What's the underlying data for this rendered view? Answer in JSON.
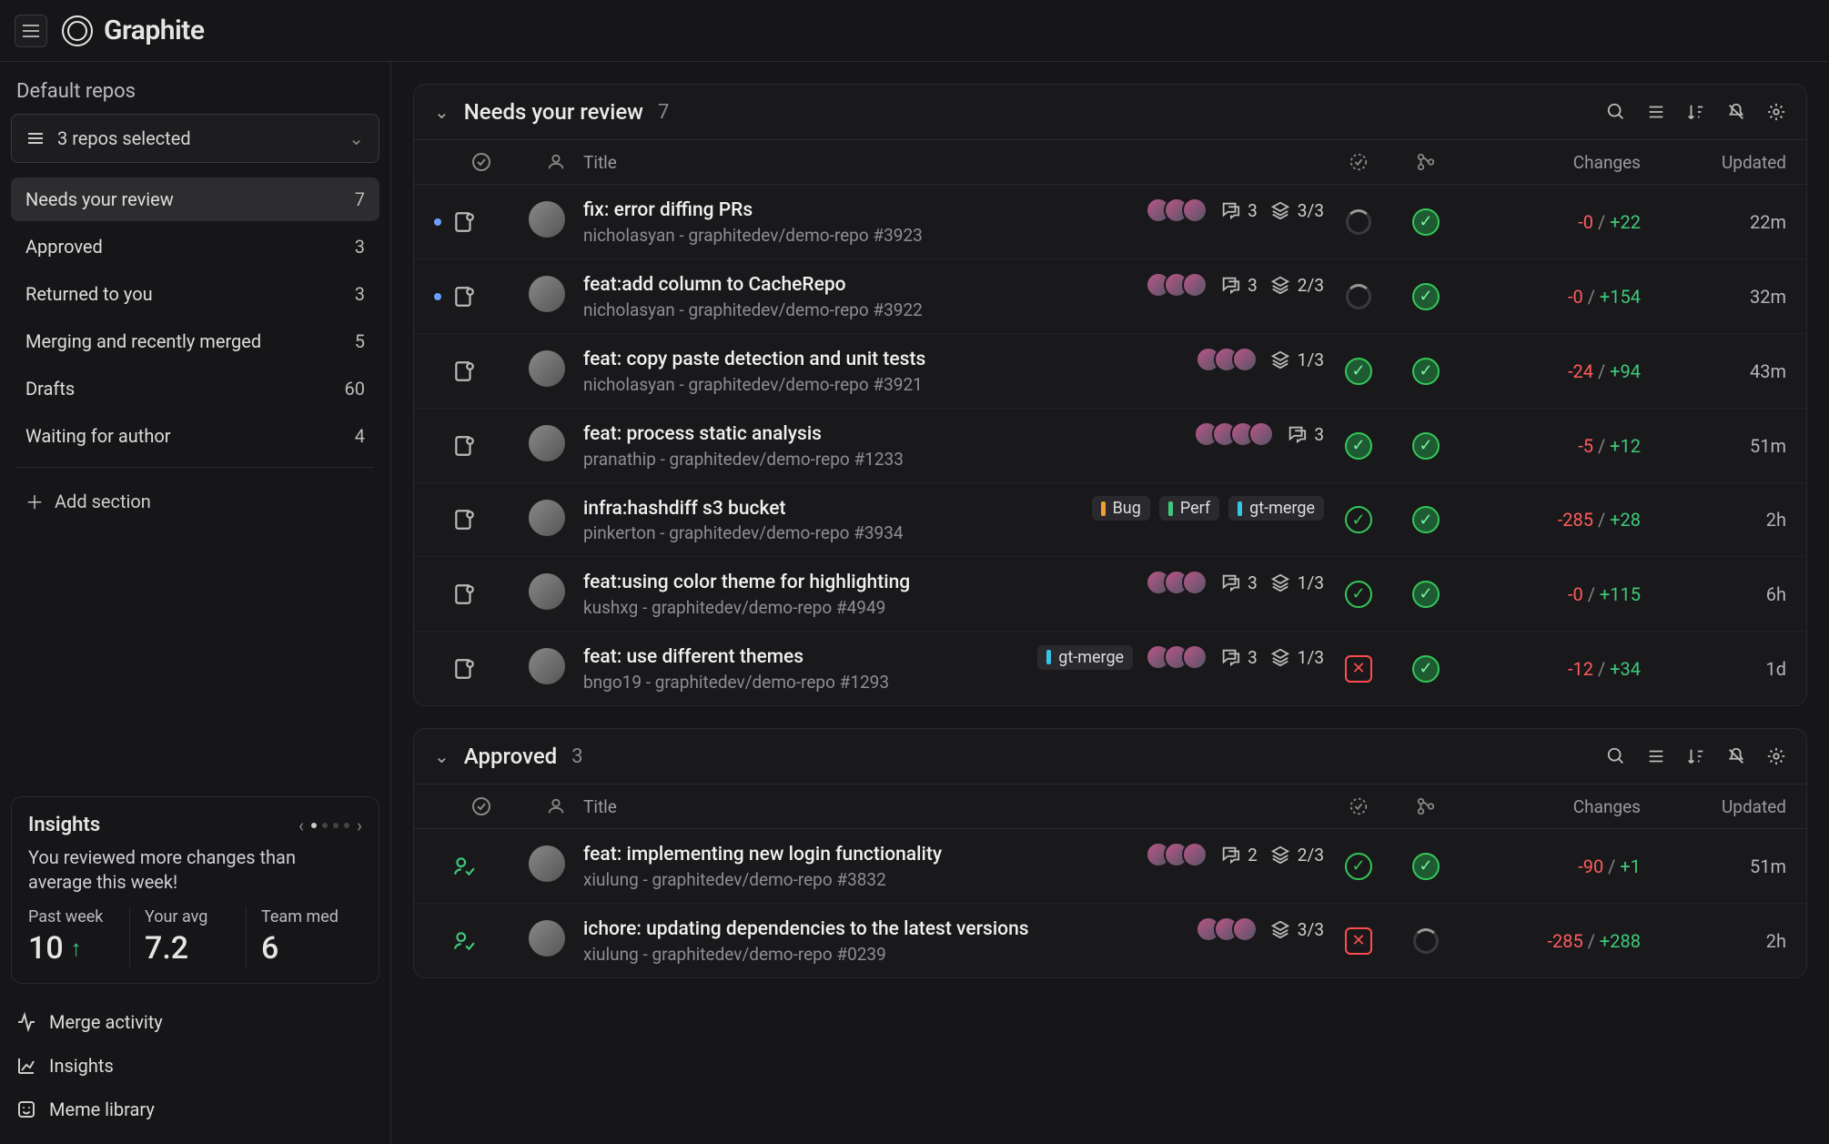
{
  "brand": "Graphite",
  "sidebar": {
    "heading": "Default repos",
    "repo_selected": "3 repos selected",
    "items": [
      {
        "label": "Needs your review",
        "count": "7"
      },
      {
        "label": "Approved",
        "count": "3"
      },
      {
        "label": "Returned to you",
        "count": "3"
      },
      {
        "label": "Merging and recently merged",
        "count": "5"
      },
      {
        "label": "Drafts",
        "count": "60"
      },
      {
        "label": "Waiting for author",
        "count": "4"
      }
    ],
    "add_section": "Add section",
    "links": {
      "merge_activity": "Merge activity",
      "insights": "Insights",
      "meme": "Meme library"
    }
  },
  "insights": {
    "title": "Insights",
    "message": "You reviewed more changes than average this week!",
    "stats": [
      {
        "label": "Past week",
        "value": "10",
        "trend": "up"
      },
      {
        "label": "Your avg",
        "value": "7.2"
      },
      {
        "label": "Team med",
        "value": "6"
      }
    ]
  },
  "columns": {
    "title": "Title",
    "changes": "Changes",
    "updated": "Updated"
  },
  "sections": [
    {
      "title": "Needs your review",
      "count": "7",
      "rows": [
        {
          "dot": true,
          "title": "fix: error diffing PRs",
          "meta": "nicholasyan - graphitedev/demo-repo #3923",
          "labels": [],
          "avatars": 3,
          "comments": "3",
          "stack": "3/3",
          "check": "spinner",
          "merge": "ok-fill",
          "del": "-0",
          "add": "+22",
          "updated": "22m"
        },
        {
          "dot": true,
          "title": "feat:add column to CacheRepo",
          "meta": "nicholasyan - graphitedev/demo-repo #3922",
          "labels": [],
          "avatars": 3,
          "comments": "3",
          "stack": "2/3",
          "check": "spinner",
          "merge": "ok-fill",
          "del": "-0",
          "add": "+154",
          "updated": "32m"
        },
        {
          "dot": false,
          "title": "feat: copy paste detection and unit tests",
          "meta": "nicholasyan - graphitedev/demo-repo #3921",
          "labels": [],
          "avatars": 3,
          "comments": "",
          "stack": "1/3",
          "check": "ok-fill",
          "merge": "ok-fill",
          "del": "-24",
          "add": "+94",
          "updated": "43m"
        },
        {
          "dot": false,
          "title": "feat: process static analysis",
          "meta": "pranathip - graphitedev/demo-repo #1233",
          "labels": [],
          "avatars": 4,
          "comments": "3",
          "stack": "",
          "check": "ok-fill",
          "merge": "ok-fill",
          "del": "-5",
          "add": "+12",
          "updated": "51m"
        },
        {
          "dot": false,
          "title": "infra:hashdiff s3 bucket",
          "meta": "pinkerton - graphitedev/demo-repo #3934",
          "labels": [
            {
              "text": "Bug",
              "class": "lab-orange"
            },
            {
              "text": "Perf",
              "class": "lab-green"
            },
            {
              "text": "gt-merge",
              "class": "lab-cyan"
            }
          ],
          "avatars": 0,
          "comments": "",
          "stack": "",
          "check": "ok-outline",
          "merge": "ok-fill",
          "del": "-285",
          "add": "+28",
          "updated": "2h"
        },
        {
          "dot": false,
          "title": "feat:using color theme for highlighting",
          "meta": "kushxg - graphitedev/demo-repo #4949",
          "labels": [],
          "avatars": 3,
          "comments": "3",
          "stack": "1/3",
          "check": "ok-outline",
          "merge": "ok-fill",
          "del": "-0",
          "add": "+115",
          "updated": "6h"
        },
        {
          "dot": false,
          "title": "feat: use different themes",
          "meta": "bngo19 - graphitedev/demo-repo #1293",
          "labels": [
            {
              "text": "gt-merge",
              "class": "lab-cyan"
            }
          ],
          "avatars": 3,
          "comments": "3",
          "stack": "1/3",
          "check": "fail",
          "merge": "ok-fill",
          "del": "-12",
          "add": "+34",
          "updated": "1d"
        }
      ]
    },
    {
      "title": "Approved",
      "count": "3",
      "rows": [
        {
          "dot": false,
          "approved": true,
          "title": "feat: implementing new login functionality",
          "meta": "xiulung - graphitedev/demo-repo #3832",
          "labels": [],
          "avatars": 3,
          "comments": "2",
          "stack": "2/3",
          "check": "ok-outline",
          "merge": "ok-fill",
          "del": "-90",
          "add": "+1",
          "updated": "51m"
        },
        {
          "dot": false,
          "approved": true,
          "title": "ichore: updating dependencies to the latest versions",
          "meta": "xiulung - graphitedev/demo-repo #0239",
          "labels": [],
          "avatars": 3,
          "comments": "",
          "stack": "3/3",
          "check": "fail",
          "merge": "spinner",
          "del": "-285",
          "add": "+288",
          "updated": "2h"
        }
      ]
    }
  ]
}
